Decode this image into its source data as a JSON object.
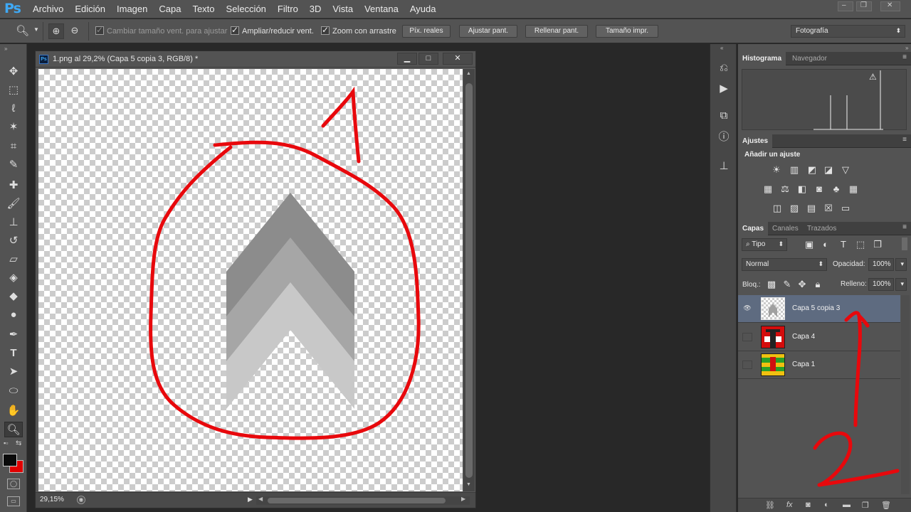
{
  "app": {
    "logo": "Ps"
  },
  "menu": [
    "Archivo",
    "Edición",
    "Imagen",
    "Capa",
    "Texto",
    "Selección",
    "Filtro",
    "3D",
    "Vista",
    "Ventana",
    "Ayuda"
  ],
  "options_bar": {
    "resize_windows": "Cambiar tamaño vent. para ajustar",
    "zoom_all": "Ampliar/reducir vent.",
    "scrubby_zoom": "Zoom con arrastre",
    "actual_pixels": "Píx. reales",
    "fit_screen": "Ajustar pant.",
    "fill_screen": "Rellenar pant.",
    "print_size": "Tamaño impr.",
    "workspace": "Fotografía"
  },
  "document": {
    "title": "1.png al 29,2% (Capa 5 copia 3, RGB/8) *",
    "icon_label": "Ps",
    "zoom": "29,15%",
    "annotation_number": "1",
    "colors": {
      "annotation": "#e8080c",
      "chevron_dark": "#8c8c8c",
      "chevron_mid": "#a6a6a6",
      "chevron_light": "#c8c8c8"
    }
  },
  "panels": {
    "histogram_tabs": [
      "Histograma",
      "Navegador"
    ],
    "histogram_warning": "⚠",
    "adjustments_tab": "Ajustes",
    "adjustments_heading": "Añadir un ajuste",
    "layers_tabs": [
      "Capas",
      "Canales",
      "Trazados"
    ],
    "filter_kind": "Tipo",
    "blend_mode": "Normal",
    "opacity_label": "Opacidad:",
    "opacity_value": "100%",
    "lock_label": "Bloq.:",
    "fill_label": "Relleno:",
    "fill_value": "100%",
    "annotation_number": "2"
  },
  "layers": [
    {
      "name": "Capa 5 copia 3",
      "visible": true,
      "selected": true
    },
    {
      "name": "Capa 4",
      "visible": false,
      "selected": false
    },
    {
      "name": "Capa 1",
      "visible": false,
      "selected": false
    }
  ],
  "icons": {
    "tools": [
      "move-icon",
      "marquee-icon",
      "lasso-icon",
      "magic-wand-icon",
      "crop-icon",
      "eyedropper-icon",
      "healing-brush-icon",
      "brush-icon",
      "clone-stamp-icon",
      "history-brush-icon",
      "eraser-icon",
      "paint-bucket-icon",
      "blur-icon",
      "dodge-icon",
      "pen-icon",
      "type-icon",
      "path-selection-icon",
      "ellipse-icon",
      "hand-icon",
      "zoom-icon"
    ]
  }
}
